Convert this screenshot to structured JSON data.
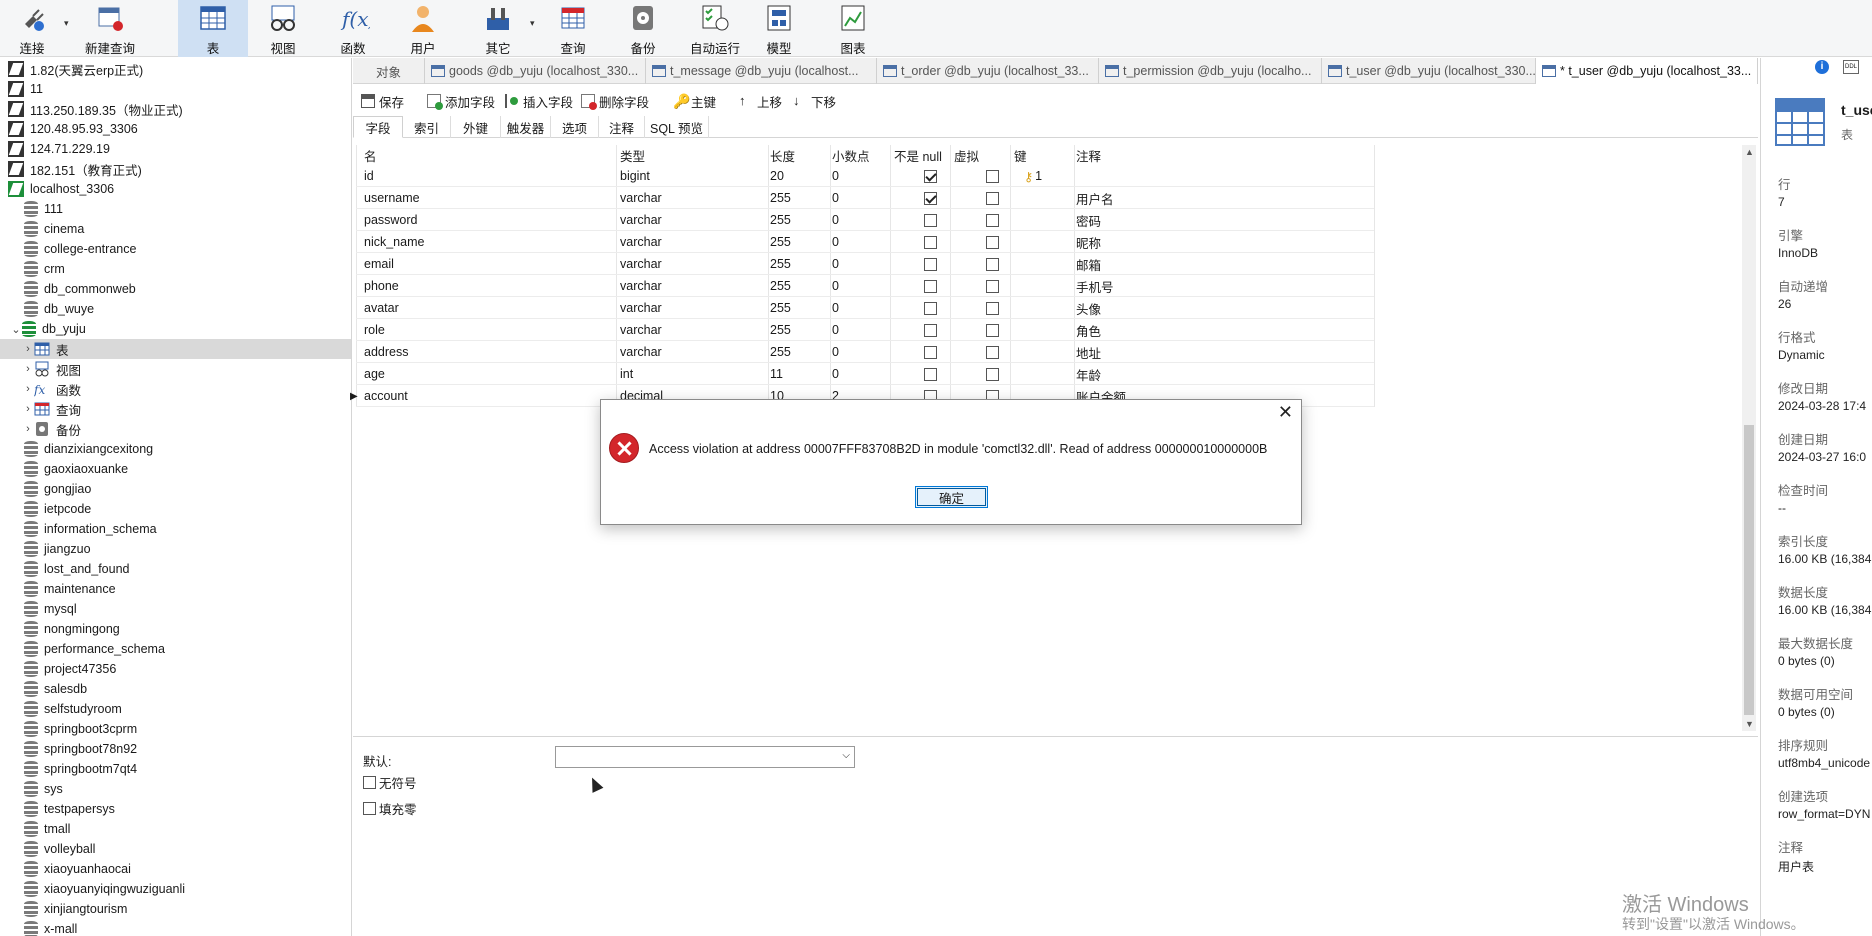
{
  "toolbar": {
    "items": [
      {
        "label": "连接",
        "icon": "plug-icon"
      },
      {
        "label": "新建查询",
        "icon": "new-query-icon"
      },
      {
        "label": "表",
        "icon": "table-icon"
      },
      {
        "label": "视图",
        "icon": "view-icon"
      },
      {
        "label": "函数",
        "icon": "function-icon"
      },
      {
        "label": "用户",
        "icon": "user-icon"
      },
      {
        "label": "其它",
        "icon": "tools-icon"
      },
      {
        "label": "查询",
        "icon": "query-icon"
      },
      {
        "label": "备份",
        "icon": "backup-icon"
      },
      {
        "label": "自动运行",
        "icon": "schedule-icon"
      },
      {
        "label": "模型",
        "icon": "model-icon"
      },
      {
        "label": "图表",
        "icon": "chart-icon"
      }
    ],
    "active": "表"
  },
  "tree": {
    "connections": [
      "1.82(天翼云erp正式)",
      "11",
      "113.250.189.35（物业正式)",
      "120.48.95.93_3306",
      "124.71.229.19",
      "182.151（教育正式)",
      "localhost_3306"
    ],
    "databases_before": [
      "111",
      "cinema",
      "college-entrance",
      "crm",
      "db_commonweb",
      "db_wuye",
      "db_yuju"
    ],
    "db_yuju_children": [
      "表",
      "视图",
      "函数",
      "查询",
      "备份"
    ],
    "databases_after": [
      "dianzixiangcexitong",
      "gaoxiaoxuanke",
      "gongjiao",
      "ietpcode",
      "information_schema",
      "jiangzuo",
      "lost_and_found",
      "maintenance",
      "mysql",
      "nongmingong",
      "performance_schema",
      "project47356",
      "salesdb",
      "selfstudyroom",
      "springboot3cprm",
      "springboot78n92",
      "springbootm7qt4",
      "sys",
      "testpapersys",
      "tmall",
      "volleyball",
      "xiaoyuanhaocai",
      "xiaoyuanyiqingwuziguanli",
      "xinjiangtourism",
      "x-mall"
    ]
  },
  "tabs": {
    "object_label": "对象",
    "items": [
      "goods @db_yuju (localhost_330...",
      "t_message @db_yuju (localhost...",
      "t_order @db_yuju (localhost_33...",
      "t_permission @db_yuju (localho...",
      "t_user @db_yuju (localhost_330...",
      "* t_user @db_yuju (localhost_33..."
    ]
  },
  "edit_toolbar": {
    "save": "保存",
    "add_field": "添加字段",
    "insert_field": "插入字段",
    "delete_field": "删除字段",
    "primary_key": "主键",
    "move_up": "上移",
    "move_down": "下移"
  },
  "sub_tabs": [
    "字段",
    "索引",
    "外键",
    "触发器",
    "选项",
    "注释",
    "SQL 预览"
  ],
  "grid": {
    "headers": [
      "名",
      "类型",
      "长度",
      "小数点",
      "不是 null",
      "虚拟",
      "键",
      "注释"
    ],
    "rows": [
      {
        "name": "id",
        "type": "bigint",
        "length": "20",
        "decimals": "0",
        "not_null": true,
        "virtual": false,
        "key": "1",
        "comment": ""
      },
      {
        "name": "username",
        "type": "varchar",
        "length": "255",
        "decimals": "0",
        "not_null": true,
        "virtual": false,
        "key": "",
        "comment": "用户名"
      },
      {
        "name": "password",
        "type": "varchar",
        "length": "255",
        "decimals": "0",
        "not_null": false,
        "virtual": false,
        "key": "",
        "comment": "密码"
      },
      {
        "name": "nick_name",
        "type": "varchar",
        "length": "255",
        "decimals": "0",
        "not_null": false,
        "virtual": false,
        "key": "",
        "comment": "昵称"
      },
      {
        "name": "email",
        "type": "varchar",
        "length": "255",
        "decimals": "0",
        "not_null": false,
        "virtual": false,
        "key": "",
        "comment": "邮箱"
      },
      {
        "name": "phone",
        "type": "varchar",
        "length": "255",
        "decimals": "0",
        "not_null": false,
        "virtual": false,
        "key": "",
        "comment": "手机号"
      },
      {
        "name": "avatar",
        "type": "varchar",
        "length": "255",
        "decimals": "0",
        "not_null": false,
        "virtual": false,
        "key": "",
        "comment": "头像"
      },
      {
        "name": "role",
        "type": "varchar",
        "length": "255",
        "decimals": "0",
        "not_null": false,
        "virtual": false,
        "key": "",
        "comment": "角色"
      },
      {
        "name": "address",
        "type": "varchar",
        "length": "255",
        "decimals": "0",
        "not_null": false,
        "virtual": false,
        "key": "",
        "comment": "地址"
      },
      {
        "name": "age",
        "type": "int",
        "length": "11",
        "decimals": "0",
        "not_null": false,
        "virtual": false,
        "key": "",
        "comment": "年龄"
      },
      {
        "name": "account",
        "type": "decimal",
        "length": "10",
        "decimals": "2",
        "not_null": false,
        "virtual": false,
        "key": "",
        "comment": "账户余额"
      }
    ]
  },
  "props": {
    "default_label": "默认:",
    "unsigned_label": "无符号",
    "zerofill_label": "填充零"
  },
  "info": {
    "title": "t_use",
    "subtitle": "表",
    "fields": [
      {
        "label": "行",
        "value": "7"
      },
      {
        "label": "引擎",
        "value": "InnoDB"
      },
      {
        "label": "自动递增",
        "value": "26"
      },
      {
        "label": "行格式",
        "value": "Dynamic"
      },
      {
        "label": "修改日期",
        "value": "2024-03-28 17:4"
      },
      {
        "label": "创建日期",
        "value": "2024-03-27 16:0"
      },
      {
        "label": "检查时间",
        "value": "--"
      },
      {
        "label": "索引长度",
        "value": "16.00 KB (16,384"
      },
      {
        "label": "数据长度",
        "value": "16.00 KB (16,384"
      },
      {
        "label": "最大数据长度",
        "value": "0 bytes (0)"
      },
      {
        "label": "数据可用空间",
        "value": "0 bytes (0)"
      },
      {
        "label": "排序规则",
        "value": "utf8mb4_unicode"
      },
      {
        "label": "创建选项",
        "value": "row_format=DYN"
      },
      {
        "label": "注释",
        "value": "用户表"
      }
    ]
  },
  "dialog": {
    "message": "Access violation at address 00007FFF83708B2D in module 'comctl32.dll'. Read of address 000000010000000B",
    "ok_label": "确定"
  },
  "watermark": {
    "title": "激活 Windows",
    "subtitle": "转到\"设置\"以激活 Windows。"
  },
  "colors": {
    "accent": "#cfe0f3",
    "error_red": "#d3262b",
    "key_gold": "#d9a11a",
    "connection_green": "#1d8f3a"
  }
}
